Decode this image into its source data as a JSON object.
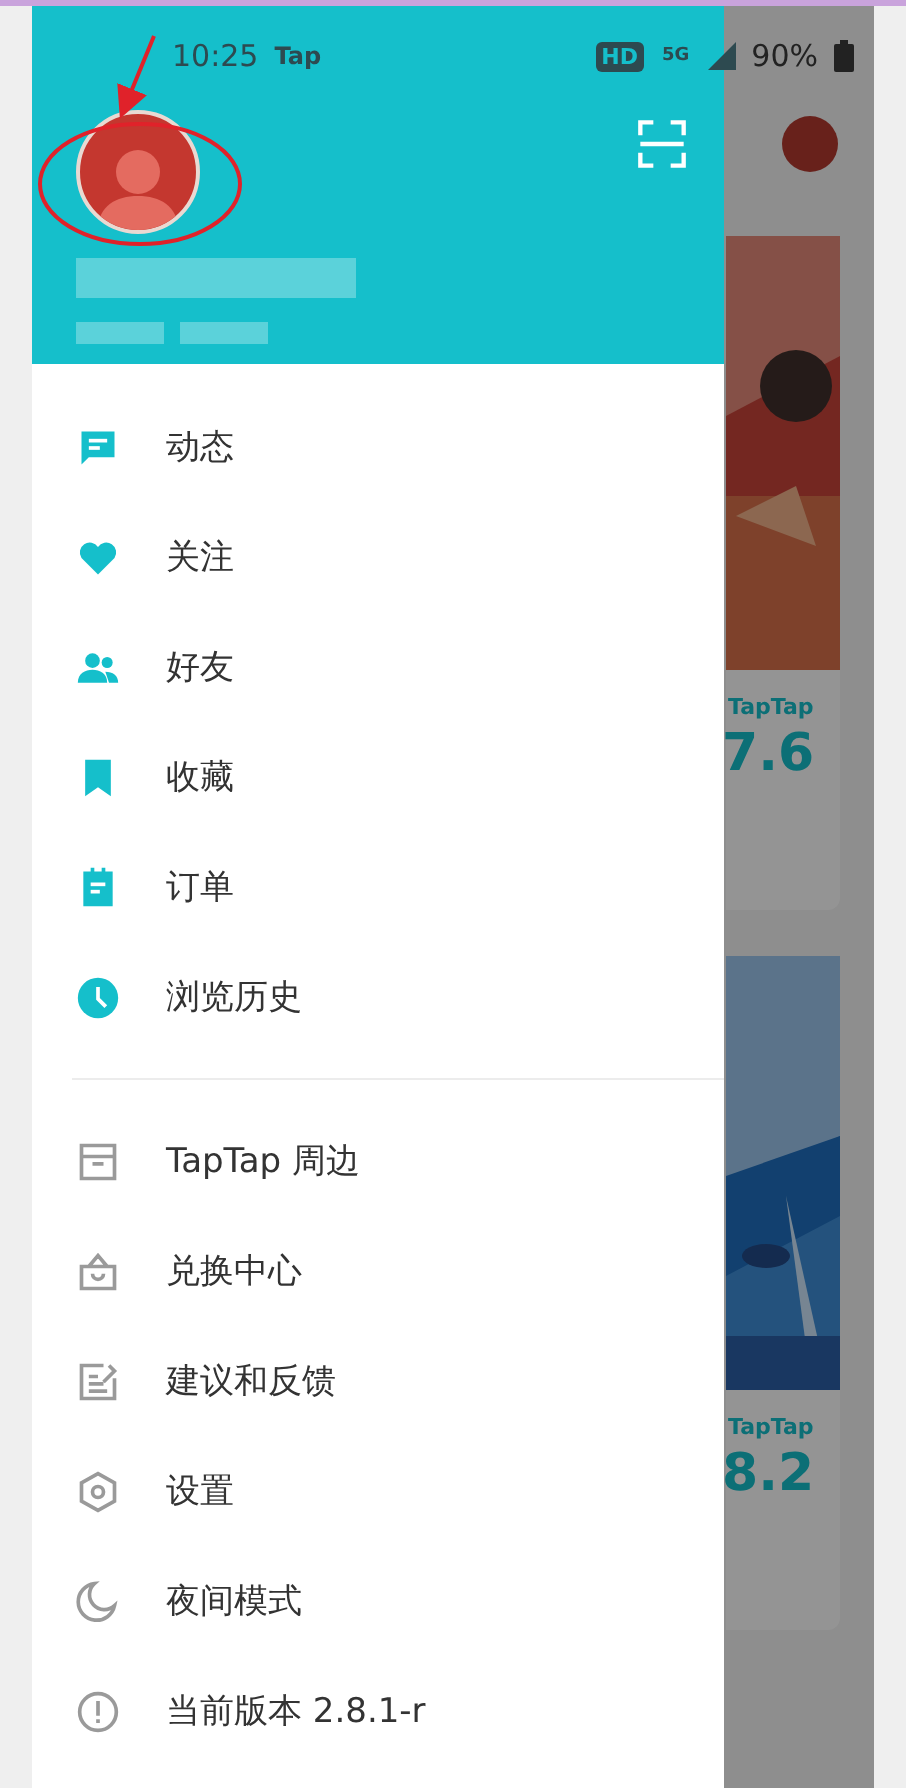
{
  "status_bar": {
    "time": "10:25",
    "app_badge": "Tap",
    "network_badge": "HD",
    "signal_label": "5G",
    "battery": "90%"
  },
  "primary_items": [
    {
      "label": "动态"
    },
    {
      "label": "关注"
    },
    {
      "label": "好友"
    },
    {
      "label": "收藏"
    },
    {
      "label": "订单"
    },
    {
      "label": "浏览历史"
    }
  ],
  "secondary_items": [
    {
      "label": "TapTap 周边"
    },
    {
      "label": "兑换中心"
    },
    {
      "label": "建议和反馈"
    },
    {
      "label": "设置"
    },
    {
      "label": "夜间模式"
    },
    {
      "label": "当前版本 2.8.1-r"
    }
  ],
  "background_feed": {
    "cards": [
      {
        "brand": "TapTap",
        "score": "7.6",
        "kind": "picture"
      },
      {
        "brand": "TapTap",
        "score": "8.2",
        "kind": "picture"
      }
    ]
  }
}
